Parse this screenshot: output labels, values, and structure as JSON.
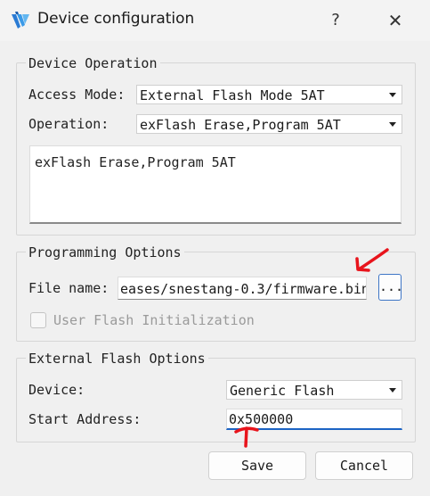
{
  "window": {
    "title": "Device configuration",
    "help_label": "?",
    "close_label": "✕",
    "app_icon": "gowin-logo-icon"
  },
  "device_operation": {
    "group_title": "Device Operation",
    "access_mode_label": "Access Mode:",
    "access_mode_value": "External Flash Mode 5AT",
    "operation_label": "Operation:",
    "operation_value": "exFlash Erase,Program 5AT",
    "description": "exFlash Erase,Program 5AT"
  },
  "programming_options": {
    "group_title": "Programming Options",
    "file_name_label": "File name:",
    "file_name_value": "eases/snestang-0.3/firmware.bin",
    "browse_label": "...",
    "user_flash_label": "User Flash Initialization",
    "user_flash_checked": false
  },
  "external_flash_options": {
    "group_title": "External Flash Options",
    "device_label": "Device:",
    "device_value": "Generic Flash",
    "start_address_label": "Start Address:",
    "start_address_value": "0x500000"
  },
  "buttons": {
    "save_label": "Save",
    "cancel_label": "Cancel"
  },
  "annotations": {
    "color": "#e8141c"
  }
}
